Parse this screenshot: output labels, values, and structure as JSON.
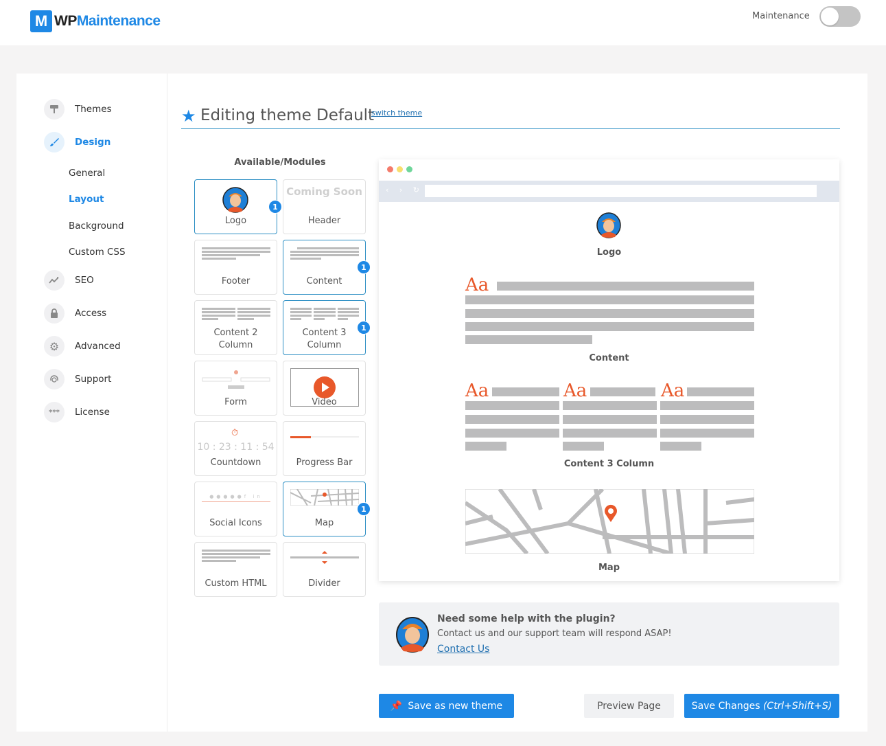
{
  "header": {
    "logo_mark": "M",
    "logo_wp": "WP",
    "logo_name": "Maintenance",
    "maintenance_label": "Maintenance",
    "maintenance_enabled": false
  },
  "sidebar": {
    "items": [
      {
        "label": "Themes",
        "icon": "paint-roller-icon"
      },
      {
        "label": "Design",
        "icon": "brush-icon",
        "active": true
      },
      {
        "label": "SEO",
        "icon": "chart-line-icon"
      },
      {
        "label": "Access",
        "icon": "lock-icon"
      },
      {
        "label": "Advanced",
        "icon": "gear-icon"
      },
      {
        "label": "Support",
        "icon": "headset-icon"
      },
      {
        "label": "License",
        "icon": "key-asterisk-icon"
      }
    ],
    "design_subitems": [
      {
        "label": "General"
      },
      {
        "label": "Layout",
        "active": true
      },
      {
        "label": "Background"
      },
      {
        "label": "Custom CSS"
      }
    ]
  },
  "main": {
    "title": "Editing theme Default",
    "switch_theme_link": "switch theme",
    "modules_title": "Available/Modules",
    "modules": [
      {
        "label": "Logo",
        "selected": true,
        "count": "1"
      },
      {
        "label": "Header",
        "thumb_text": "Coming Soon",
        "selected": false
      },
      {
        "label": "Footer",
        "selected": false
      },
      {
        "label": "Content",
        "selected": true,
        "count": "1"
      },
      {
        "label": "Content 2 Column",
        "selected": false
      },
      {
        "label": "Content 3 Column",
        "selected": true,
        "count": "1"
      },
      {
        "label": "Form",
        "selected": false
      },
      {
        "label": "Video",
        "selected": false
      },
      {
        "label": "Countdown",
        "thumb_text": "10 : 23 : 11 : 54",
        "selected": false
      },
      {
        "label": "Progress Bar",
        "selected": false
      },
      {
        "label": "Social Icons",
        "selected": false
      },
      {
        "label": "Map",
        "selected": true,
        "count": "1"
      },
      {
        "label": "Custom HTML",
        "selected": false
      },
      {
        "label": "Divider",
        "selected": false
      }
    ],
    "preview": {
      "sections": [
        "Logo",
        "Content",
        "Content 3 Column",
        "Map"
      ],
      "aa_text": "Aa"
    },
    "help": {
      "title": "Need some help with the plugin?",
      "text": "Contact us and our support team will respond ASAP!",
      "link": "Contact Us"
    },
    "buttons": {
      "save_new_theme": "Save as new theme",
      "preview_page": "Preview Page",
      "save_changes": "Save Changes",
      "save_changes_shortcut": "(Ctrl+Shift+S)"
    }
  },
  "colors": {
    "accent": "#1e88e5",
    "orange": "#e8582a",
    "placeholder_grey": "#bcbcbd"
  }
}
